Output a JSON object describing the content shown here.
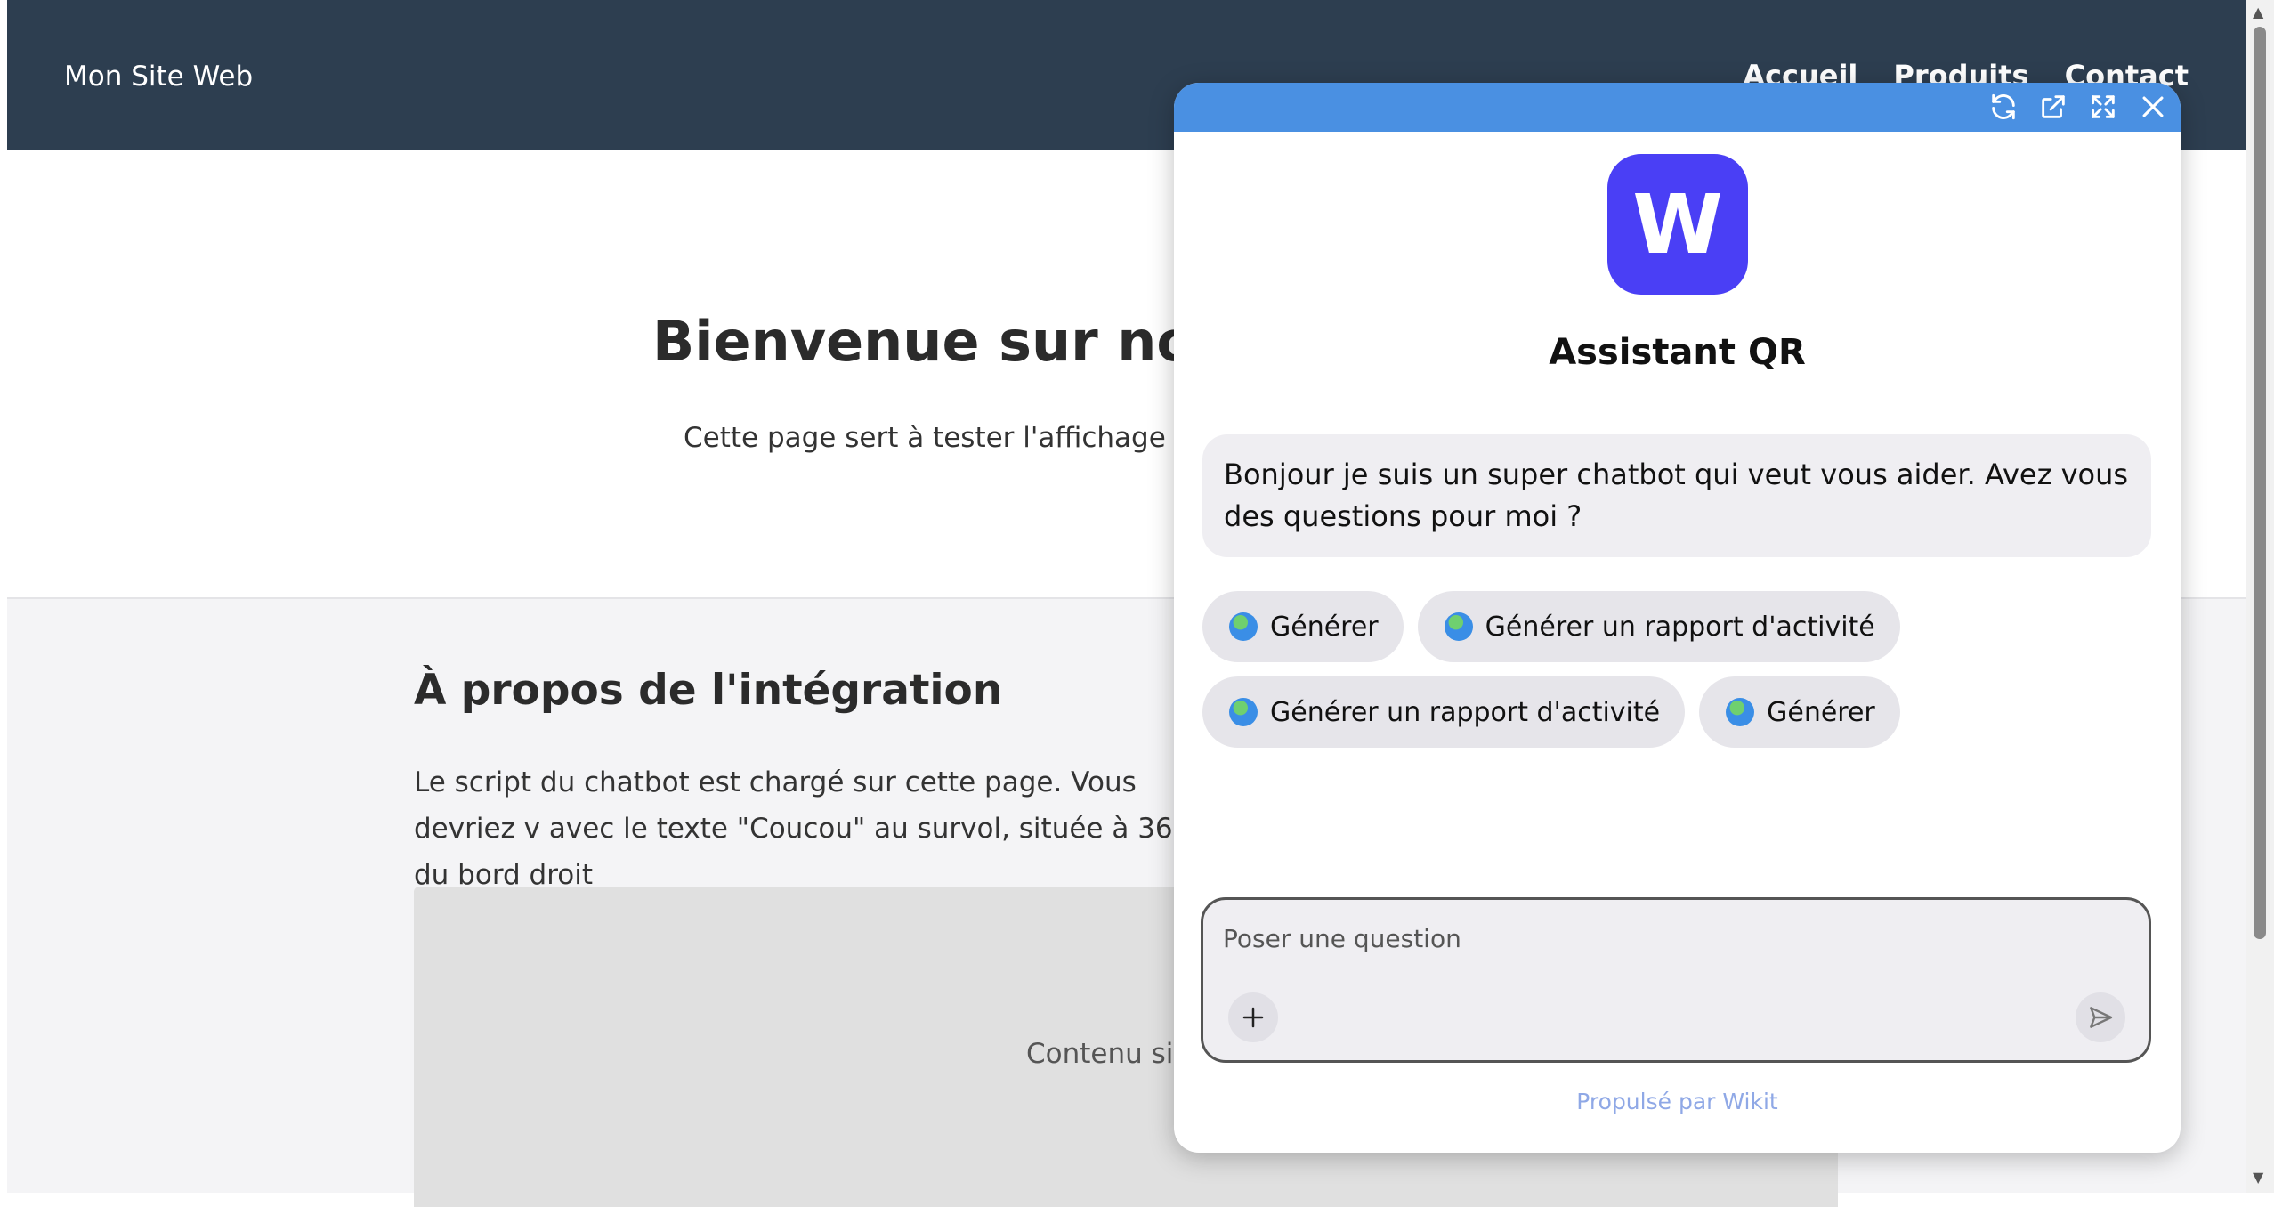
{
  "site": {
    "logo": "Mon Site Web",
    "nav": [
      "Accueil",
      "Produits",
      "Contact"
    ],
    "hero_title": "Bienvenue sur notre",
    "hero_subtitle": "Cette page sert à tester l'affichage de l'",
    "about_title": "À propos de l'intégration",
    "about_text": "Le script du chatbot est chargé sur cette page. Vous devriez v avec le texte \"Coucou\" au survol, située à 36px du bord droit",
    "sim_text": "Contenu sim"
  },
  "chat": {
    "avatar_letter": "W",
    "bot_name": "Assistant QR",
    "greeting": "Bonjour je suis un super chatbot qui veut vous aider. Avez vous des questions pour moi ?",
    "suggestions_row1": [
      "Générer",
      "Générer un rapport d'activité"
    ],
    "suggestions_row2": [
      "Générer un rapport d'activité",
      "Générer"
    ],
    "input_placeholder": "Poser une question",
    "powered_by": "Propulsé par Wikit",
    "colors": {
      "topbar": "#4a90e2",
      "avatar": "#4a3ff5",
      "header": "#2d3e50"
    },
    "icons": [
      "refresh-icon",
      "external-link-icon",
      "expand-icon",
      "close-icon",
      "plus-icon",
      "send-icon",
      "globe-icon"
    ]
  }
}
